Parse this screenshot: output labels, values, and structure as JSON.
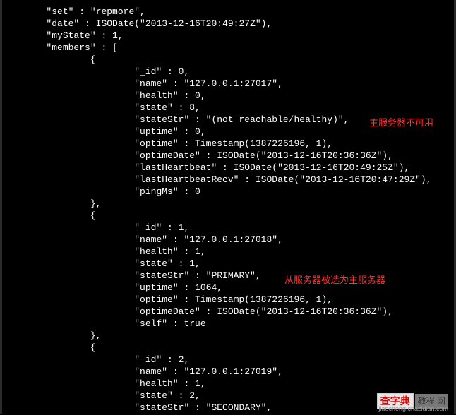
{
  "doc": {
    "set_key": "\"set\"",
    "set_val": " : \"repmore\",",
    "date_key": "\"date\"",
    "date_val": " : ISODate(\"2013-12-16T20:49:27Z\"),",
    "mystate_key": "\"myState\"",
    "mystate_val": " : 1,",
    "members_key": "\"members\"",
    "members_open": " : [",
    "brace_open": "{",
    "brace_close": "},",
    "m0": {
      "id": "\"_id\" : 0,",
      "name": "\"name\" : \"127.0.0.1:27017\",",
      "health": "\"health\" : 0,",
      "state": "\"state\" : 8,",
      "stateStr": "\"stateStr\" : \"(not reachable/healthy)\",",
      "uptime": "\"uptime\" : 0,",
      "optime": "\"optime\" : Timestamp(1387226196, 1),",
      "optimeDate": "\"optimeDate\" : ISODate(\"2013-12-16T20:36:36Z\"),",
      "lastHeartbeat": "\"lastHeartbeat\" : ISODate(\"2013-12-16T20:49:25Z\"),",
      "lastHeartbeatRecv": "\"lastHeartbeatRecv\" : ISODate(\"2013-12-16T20:47:29Z\"),",
      "pingMs": "\"pingMs\" : 0"
    },
    "m1": {
      "id": "\"_id\" : 1,",
      "name": "\"name\" : \"127.0.0.1:27018\",",
      "health": "\"health\" : 1,",
      "state": "\"state\" : 1,",
      "stateStr": "\"stateStr\" : \"PRIMARY\",",
      "uptime": "\"uptime\" : 1064,",
      "optime": "\"optime\" : Timestamp(1387226196, 1),",
      "optimeDate": "\"optimeDate\" : ISODate(\"2013-12-16T20:36:36Z\"),",
      "self": "\"self\" : true"
    },
    "m2": {
      "id": "\"_id\" : 2,",
      "name": "\"name\" : \"127.0.0.1:27019\",",
      "health": "\"health\" : 1,",
      "state": "\"state\" : 2,",
      "stateStr": "\"stateStr\" : \"SECONDARY\","
    }
  },
  "annotations": {
    "a1": "主服务器不可用",
    "a2": "从服务器被选为主服务器"
  },
  "watermark": {
    "box1": "查字典",
    "box2": "教程 网",
    "url": "jiaocheng.chazidian.com"
  },
  "indent": {
    "i1": "        ",
    "i2": "                ",
    "i3": "                        "
  }
}
